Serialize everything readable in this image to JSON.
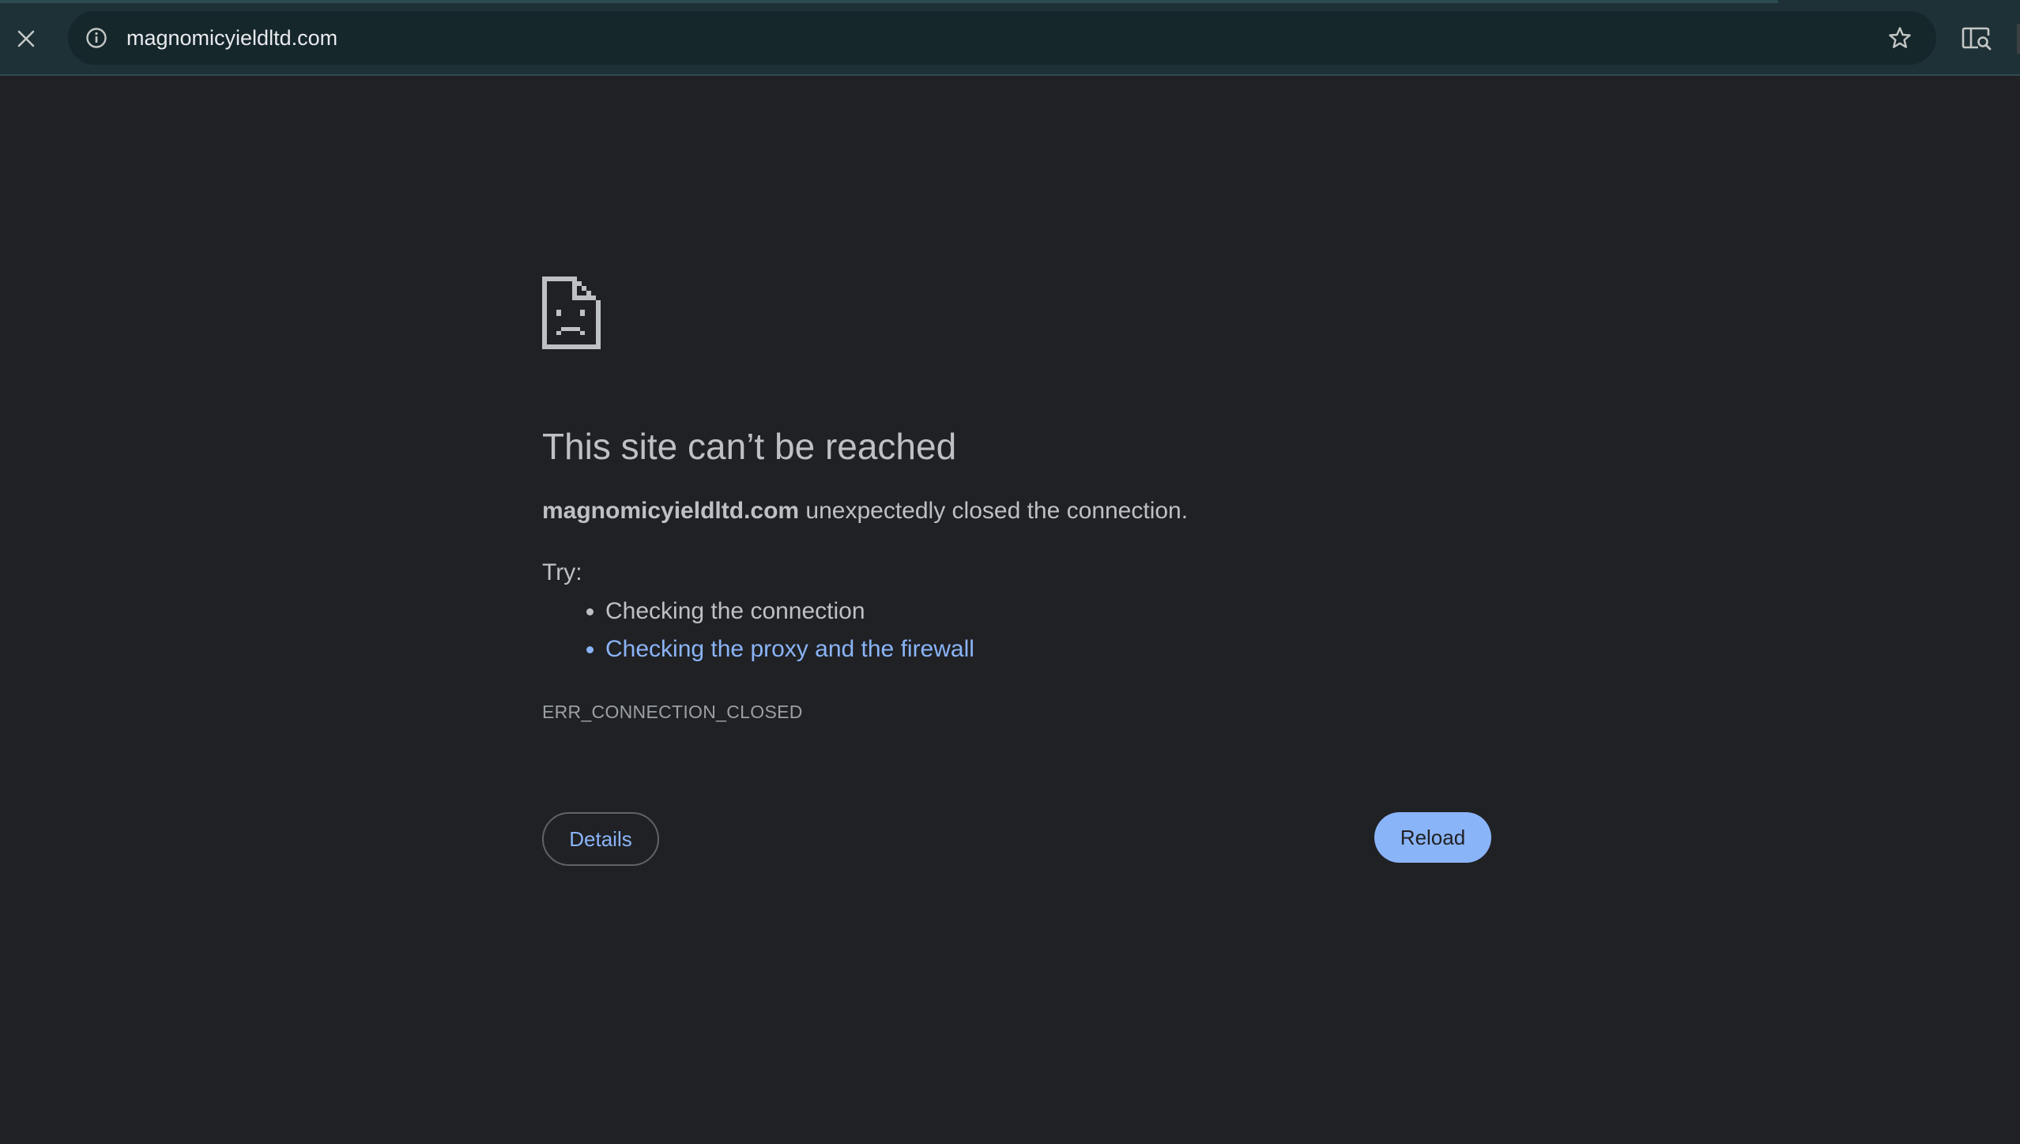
{
  "browser": {
    "url": "magnomicyieldltd.com",
    "icons": {
      "close": "close-icon",
      "site_info": "info-icon",
      "bookmark": "star-icon",
      "side_panel_search": "side-panel-search-icon"
    }
  },
  "error_page": {
    "icon": "sad-page-icon",
    "heading": "This site can’t be reached",
    "host": "magnomicyieldltd.com",
    "message": " unexpectedly closed the connection.",
    "try_label": "Try:",
    "suggestions": [
      "Checking the connection",
      "Checking the proxy and the firewall"
    ],
    "error_code": "ERR_CONNECTION_CLOSED",
    "details_label": "Details",
    "reload_label": "Reload"
  },
  "colors": {
    "background": "#202124",
    "toolbar": "#1e3136",
    "link": "#8ab4f8",
    "text": "#bdc1c6"
  }
}
